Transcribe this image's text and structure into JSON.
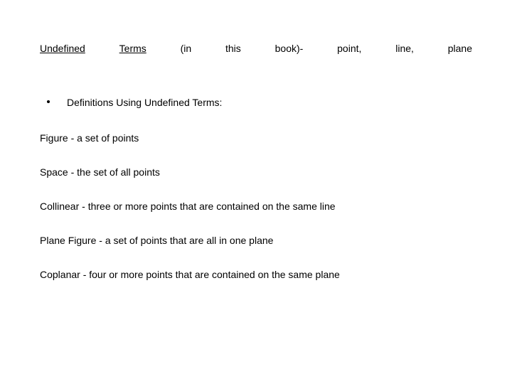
{
  "heading": {
    "w1": "Undefined",
    "w2": "Terms",
    "w3": "(in",
    "w4": "this",
    "w5": "book)-",
    "w6": "point,",
    "w7": "line,",
    "w8": "plane"
  },
  "bullet": {
    "text": "Definitions Using Undefined Terms:"
  },
  "defs": {
    "figure": "Figure - a set of points",
    "space": "Space - the set of all points",
    "collinear": "Collinear - three or more points that are contained on the same line",
    "plane_figure": "Plane Figure - a set of points that are all in one plane",
    "coplanar": "Coplanar - four or more points that are contained on the same plane"
  }
}
